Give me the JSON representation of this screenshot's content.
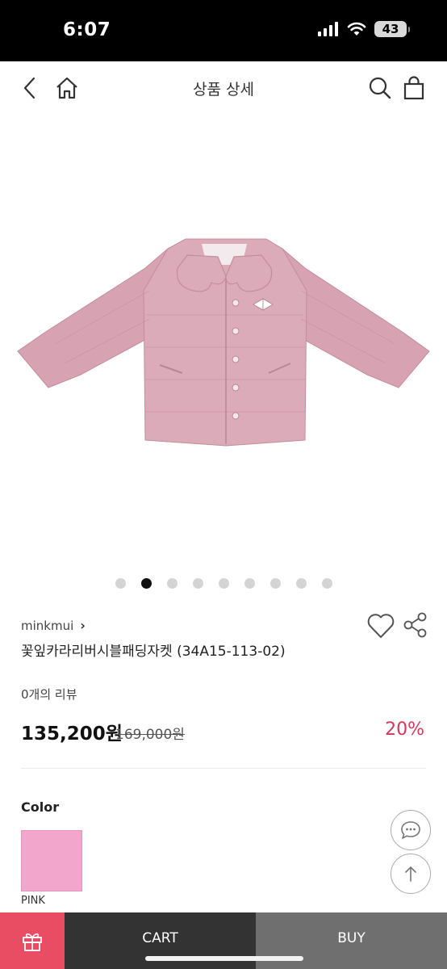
{
  "status_bar": {
    "time": "6:07",
    "battery": "43"
  },
  "nav": {
    "title": "상품 상세"
  },
  "gallery": {
    "dot_count": 9,
    "active_index": 1
  },
  "product": {
    "brand": "minkmui",
    "brand_chevron": "›",
    "name": "꽃잎카라리버시블패딩자켓 (34A15-113-02)",
    "reviews": "0개의 리뷰",
    "price": "135,200원",
    "original_price": "169,000원",
    "discount": "20%"
  },
  "options": {
    "color_label": "Color",
    "colors": [
      {
        "name": "PINK",
        "hex": "#f2a6cb"
      }
    ]
  },
  "bottom_bar": {
    "cart_label": "CART",
    "buy_label": "BUY"
  },
  "theme": {
    "accent": "#e84d64",
    "discount_color": "#d4385b"
  }
}
